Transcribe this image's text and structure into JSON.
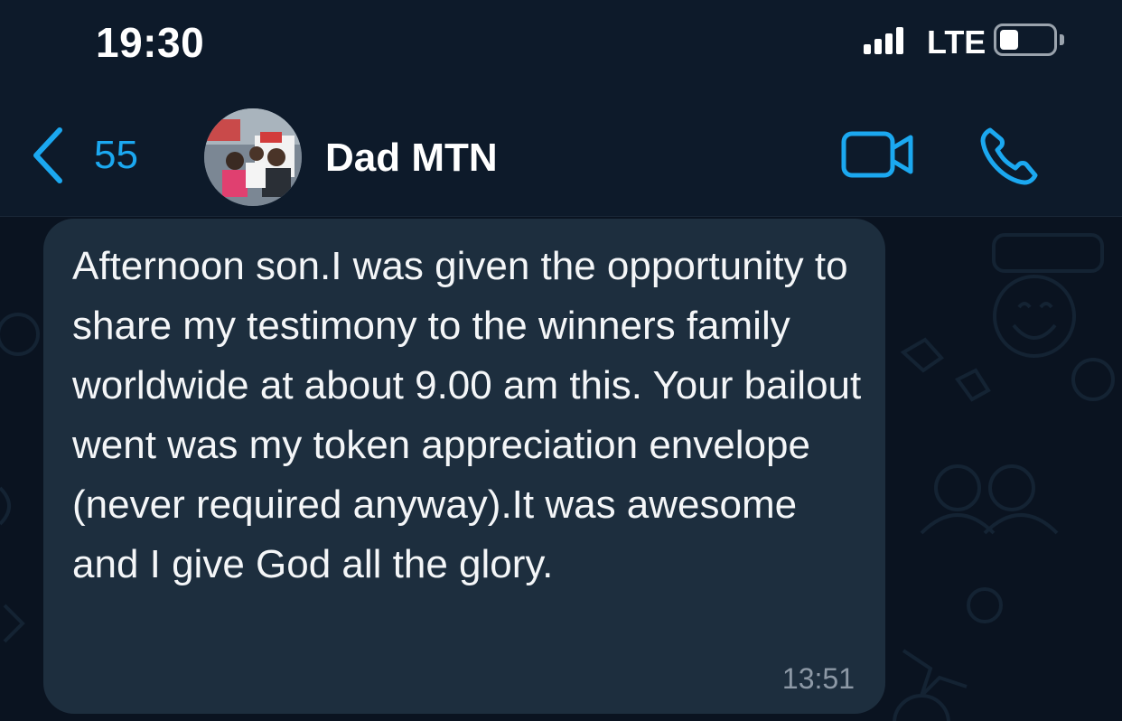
{
  "status_bar": {
    "time": "19:30",
    "network": "LTE",
    "signal_bars": 4,
    "battery_level": 0.35
  },
  "header": {
    "back_count": "55",
    "contact_name": "Dad MTN",
    "icons": [
      "chevron-left-icon",
      "video-camera-icon",
      "phone-icon"
    ],
    "accent_color": "#1ba8f0"
  },
  "messages": [
    {
      "text": "Afternoon son.I was given the opportunity to share my testimony to the winners family worldwide at about 9.00 am this. Your bailout went was my token appreciation envelope (never required anyway).It was awesome and I give God all the glory.",
      "time": "13:51",
      "direction": "incoming"
    }
  ],
  "colors": {
    "background": "#0a1320",
    "header": "#0d1a2a",
    "bubble": "#1d2e3e"
  }
}
